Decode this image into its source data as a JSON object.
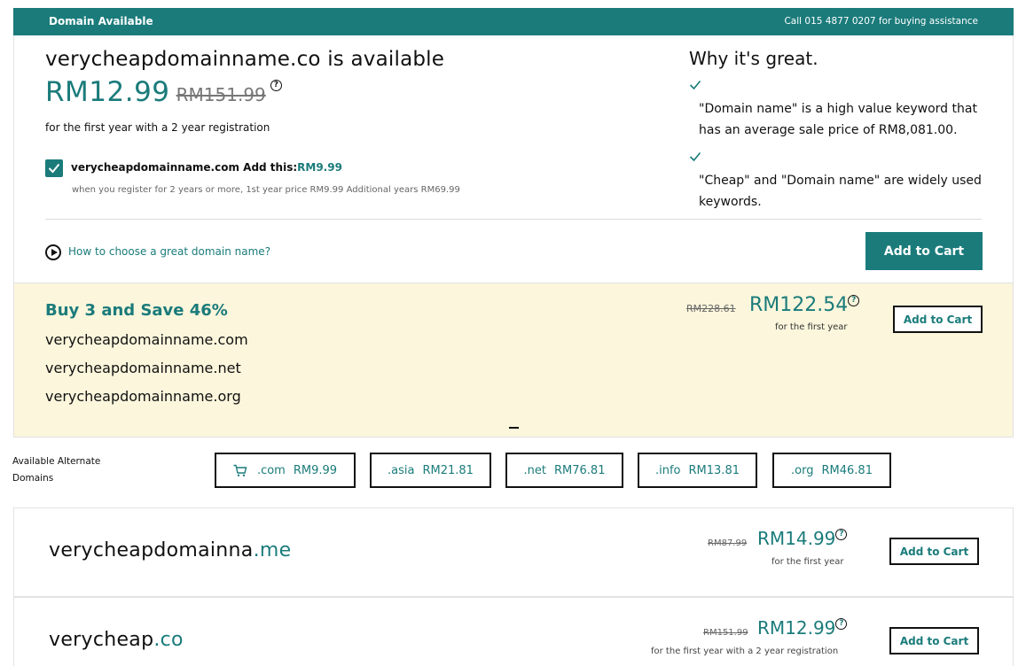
{
  "header": {
    "title": "Domain Available",
    "assist": "Call 015 4877 0207 for buying assistance"
  },
  "main": {
    "headline": "verycheapdomainname.co is available",
    "price": "RM12.99",
    "old_price": "RM151.99",
    "term_note": "for the first year with a 2 year registration",
    "addon": {
      "checked": true,
      "label": "verycheapdomainname.com Add this:",
      "price": "RM9.99",
      "note": "when you register for 2 years or more, 1st year price RM9.99 Additional years RM69.99"
    },
    "why": {
      "title": "Why it's great.",
      "items": [
        "\"Domain name\" is a high value keyword that has an average sale price of RM8,081.00.",
        "\"Cheap\" and \"Domain name\" are widely used keywords."
      ]
    },
    "howto_link": "How to choose a great domain name?",
    "add_to_cart": "Add to Cart"
  },
  "bundle": {
    "title": "Buy 3 and Save 46%",
    "domains": [
      "verycheapdomainname.com",
      "verycheapdomainname.net",
      "verycheapdomainname.org"
    ],
    "old_price": "RM228.61",
    "price": "RM122.54",
    "term": "for the first year",
    "add_to_cart": "Add to Cart"
  },
  "alternates": {
    "label": "Available Alternate Domains",
    "chips": [
      {
        "tld": ".com",
        "price": "RM9.99",
        "icon": "cart-icon"
      },
      {
        "tld": ".asia",
        "price": "RM21.81"
      },
      {
        "tld": ".net",
        "price": "RM76.81"
      },
      {
        "tld": ".info",
        "price": "RM13.81"
      },
      {
        "tld": ".org",
        "price": "RM46.81"
      }
    ]
  },
  "suggestions": [
    {
      "base": "verycheapdomainna",
      "tld": ".me",
      "old_price": "RM87.99",
      "price": "RM14.99",
      "term": "for the first year",
      "add_to_cart": "Add to Cart"
    },
    {
      "base": "verycheap",
      "tld": ".co",
      "old_price": "RM151.99",
      "price": "RM12.99",
      "term": "for the first year with a 2 year registration",
      "add_to_cart": "Add to Cart"
    }
  ],
  "colors": {
    "brand": "#1b7b7b",
    "bundle_bg": "#fbf6dc"
  }
}
